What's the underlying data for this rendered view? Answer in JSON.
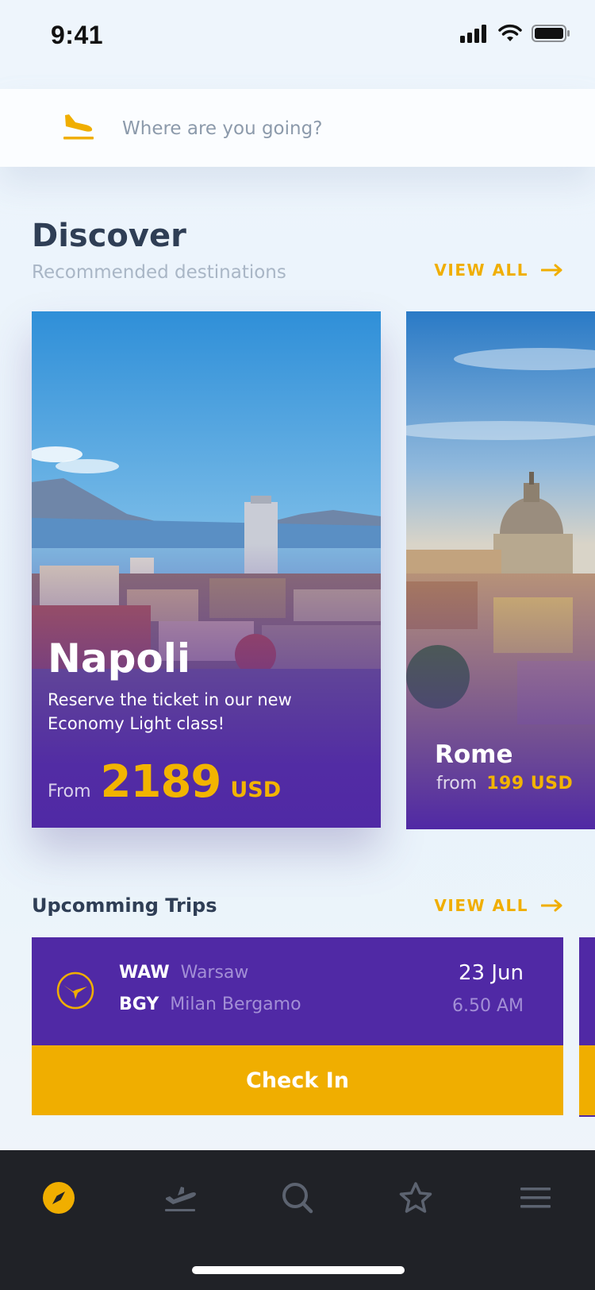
{
  "status_bar": {
    "time": "9:41"
  },
  "search": {
    "placeholder": "Where are you going?"
  },
  "discover": {
    "title": "Discover",
    "subtitle": "Recommended destinations",
    "view_all": "VIEW ALL",
    "cards": [
      {
        "city": "Napoli",
        "description": "Reserve the ticket in our new Economy Light class!",
        "from_label": "From",
        "price": "2189",
        "currency": "USD"
      },
      {
        "city": "Rome",
        "from_label": "from",
        "price": "199 USD"
      }
    ]
  },
  "trips": {
    "title": "Upcomming Trips",
    "view_all": "VIEW ALL",
    "items": [
      {
        "from_code": "WAW",
        "from_city": "Warsaw",
        "to_code": "BGY",
        "to_city": "Milan Bergamo",
        "date": "23 Jun",
        "time": "6.50 AM",
        "action": "Check In"
      }
    ]
  },
  "tab_bar": {
    "tabs": [
      {
        "name": "discover",
        "icon": "compass-icon",
        "active": true
      },
      {
        "name": "flights",
        "icon": "plane-departure-icon",
        "active": false
      },
      {
        "name": "search",
        "icon": "search-icon",
        "active": false
      },
      {
        "name": "favorites",
        "icon": "star-icon",
        "active": false
      },
      {
        "name": "menu",
        "icon": "hamburger-icon",
        "active": false
      }
    ]
  },
  "colors": {
    "accent": "#f0ae00",
    "brand_purple": "#5029a5",
    "title_text": "#2f3e55",
    "muted_text": "#a9b6c6",
    "tab_bar_bg": "#202227",
    "tab_inactive": "#5c6370"
  }
}
